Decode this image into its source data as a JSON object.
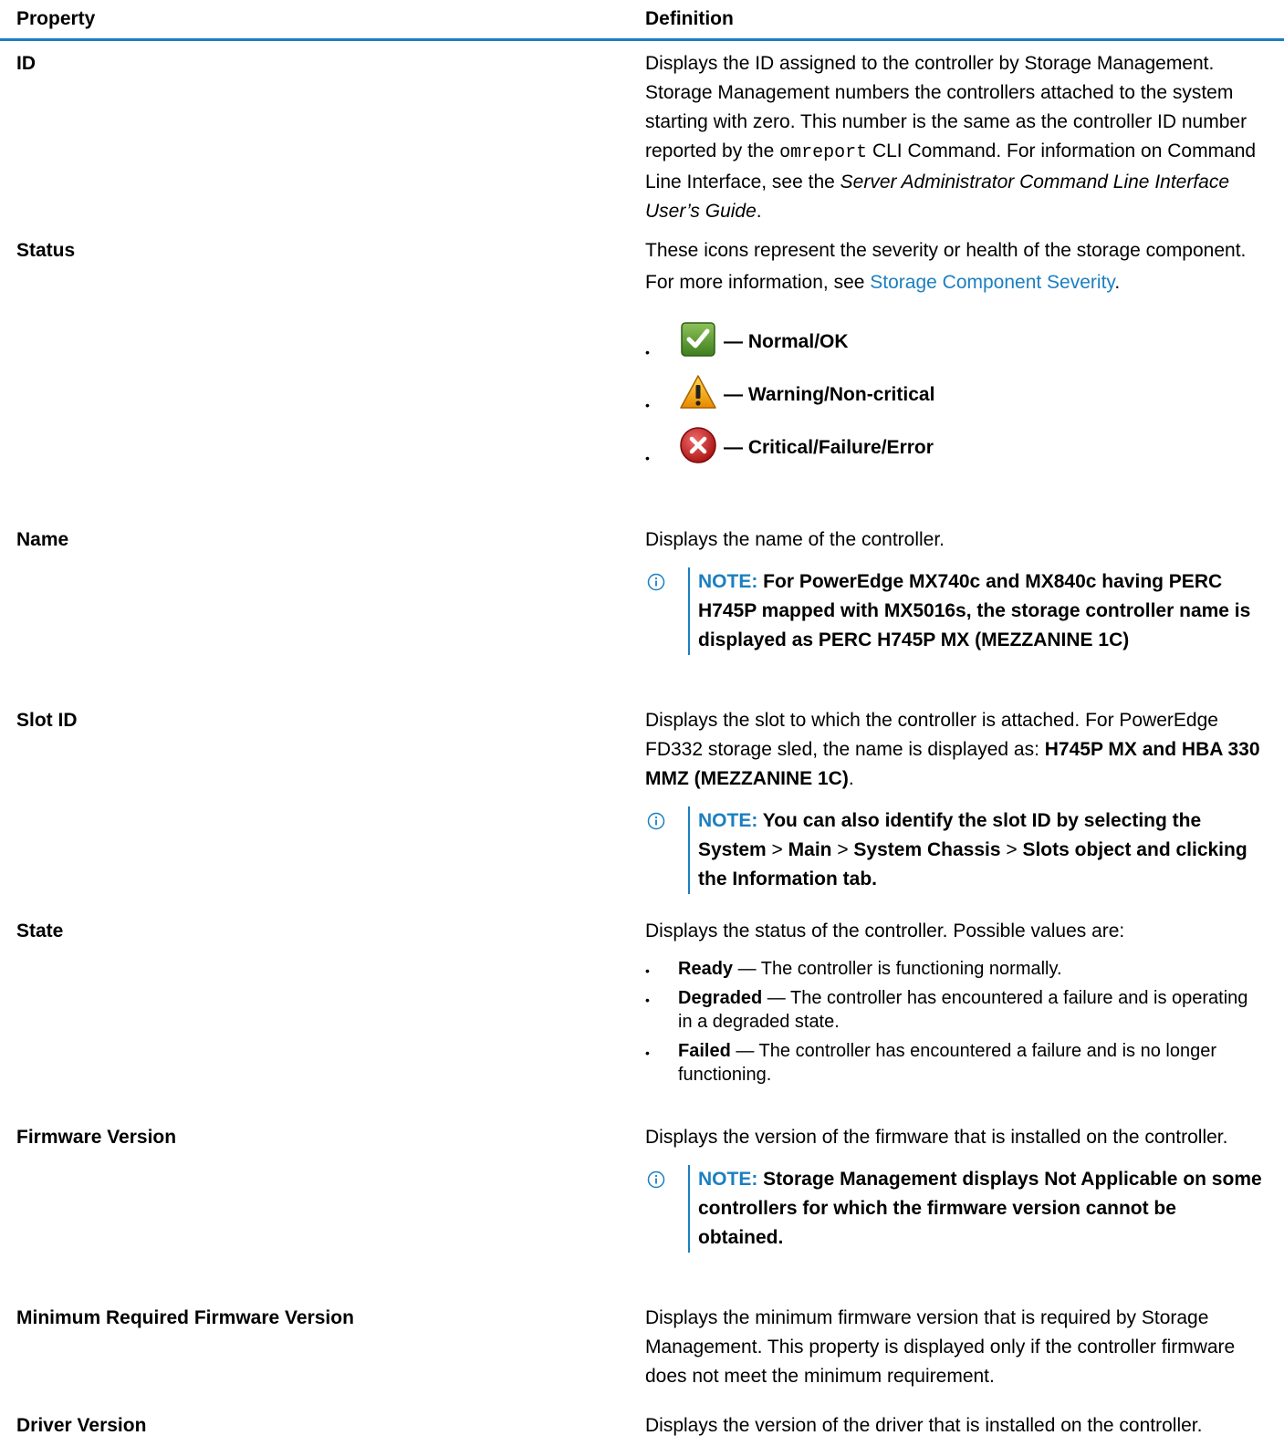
{
  "header": {
    "property": "Property",
    "definition": "Definition"
  },
  "rows": {
    "id": {
      "property": "ID",
      "def_part1": "Displays the ID assigned to the controller by Storage Management. Storage Management numbers the controllers attached to the system starting with zero. This number is the same as the controller ID number reported by the ",
      "def_cmd": "omreport",
      "def_part2": " CLI Command. For information on Command Line Interface, see the ",
      "def_italic": "Server Administrator Command Line Interface User’s Guide",
      "def_end": "."
    },
    "status": {
      "property": "Status",
      "def_line1": "These icons represent the severity or health of the storage component.",
      "def_line2_prefix": "For more information, see ",
      "def_link": "Storage Component Severity",
      "def_line2_suffix": ".",
      "items": [
        {
          "icon": "check-icon",
          "dash": "—",
          "label": "Normal/OK"
        },
        {
          "icon": "warning-icon",
          "dash": "—",
          "label": "Warning/Non-critical"
        },
        {
          "icon": "error-icon",
          "dash": "—",
          "label": "Critical/Failure/Error"
        }
      ]
    },
    "name": {
      "property": "Name",
      "definition": "Displays the name of the controller.",
      "note_label": "NOTE:",
      "note_text": " For PowerEdge MX740c and MX840c having PERC H745P mapped with MX5016s, the storage controller name is displayed as PERC H745P MX (MEZZANINE 1C)"
    },
    "slot": {
      "property": "Slot ID",
      "def_text": "Displays the slot to which the controller is attached. For PowerEdge FD332 storage sled, the name is displayed as: ",
      "def_bold": "H745P MX and HBA 330 MMZ (MEZZANINE 1C)",
      "def_end": ".",
      "note_label": "NOTE:",
      "note_text1": " You can also identify the slot ID by selecting the System ",
      "note_gt": ">",
      "note_text2": " Main ",
      "note_text3": " System Chassis ",
      "note_text4": " Slots object and clicking the Information tab."
    },
    "state": {
      "property": "State",
      "definition": "Displays the status of the controller. Possible values are:",
      "items": [
        {
          "term": "Ready",
          "desc": " — The controller is functioning normally."
        },
        {
          "term": "Degraded",
          "desc": " — The controller has encountered a failure and is operating in a degraded state."
        },
        {
          "term": "Failed",
          "desc": " — The controller has encountered a failure and is no longer functioning."
        }
      ]
    },
    "firmware": {
      "property": "Firmware Version",
      "definition": "Displays the version of the firmware that is installed on the controller.",
      "note_label": "NOTE:",
      "note_text": " Storage Management displays Not Applicable on some controllers for which the firmware version cannot be obtained."
    },
    "min_firmware": {
      "property": "Minimum Required Firmware Version",
      "definition": "Displays the minimum firmware version that is required by Storage Management. This property is displayed only if the controller firmware does not meet the minimum requirement."
    },
    "driver": {
      "property": "Driver Version",
      "definition": "Displays the version of the driver that is installed on the controller."
    }
  },
  "colors": {
    "accent": "#1b7fc1"
  }
}
